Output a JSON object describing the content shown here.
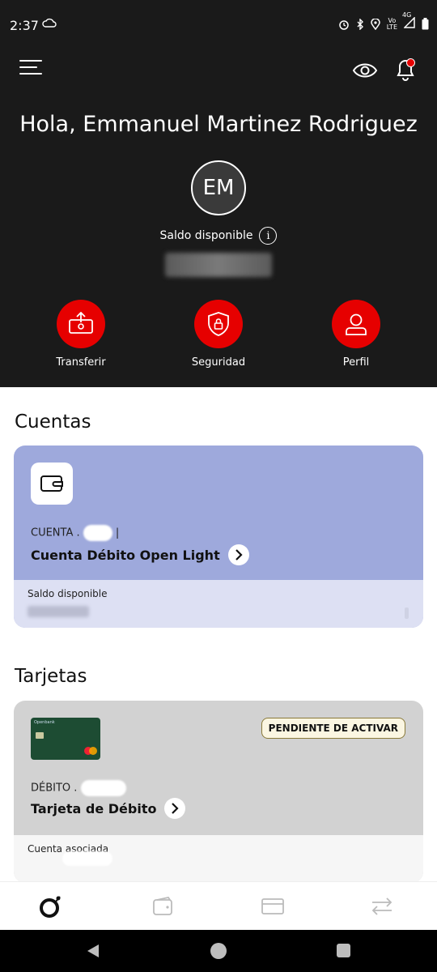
{
  "status_bar": {
    "time": "2:37",
    "network_top": "Vo",
    "network_bottom": "LTE",
    "signal_label": "4G"
  },
  "header": {
    "greeting": "Hola, Emmanuel Martinez Rodriguez",
    "avatar_initials": "EM",
    "balance_label": "Saldo disponible",
    "info_symbol": "i"
  },
  "actions": [
    {
      "label": "Transferir",
      "icon": "transfer-icon"
    },
    {
      "label": "Seguridad",
      "icon": "shield-lock-icon"
    },
    {
      "label": "Perfil",
      "icon": "person-icon"
    }
  ],
  "cuentas": {
    "title": "Cuentas",
    "account": {
      "number_prefix": "CUENTA .",
      "number_suffix": "|",
      "name": "Cuenta Débito Open Light",
      "balance_label": "Saldo disponible"
    }
  },
  "tarjetas": {
    "title": "Tarjetas",
    "card": {
      "brand_text": "Openbank",
      "status_badge": "PENDIENTE DE ACTIVAR",
      "number_prefix": "DÉBITO .",
      "name": "Tarjeta de Débito",
      "associated_label": "Cuenta asociada"
    }
  },
  "bottom_nav": [
    "home-logo-icon",
    "wallet-icon",
    "card-icon",
    "transfer-arrows-icon"
  ],
  "colors": {
    "accent": "#e60000",
    "header_bg": "#1a1a1a",
    "account_card": "#9ea9dc",
    "card_bg": "#d2d2d2"
  }
}
